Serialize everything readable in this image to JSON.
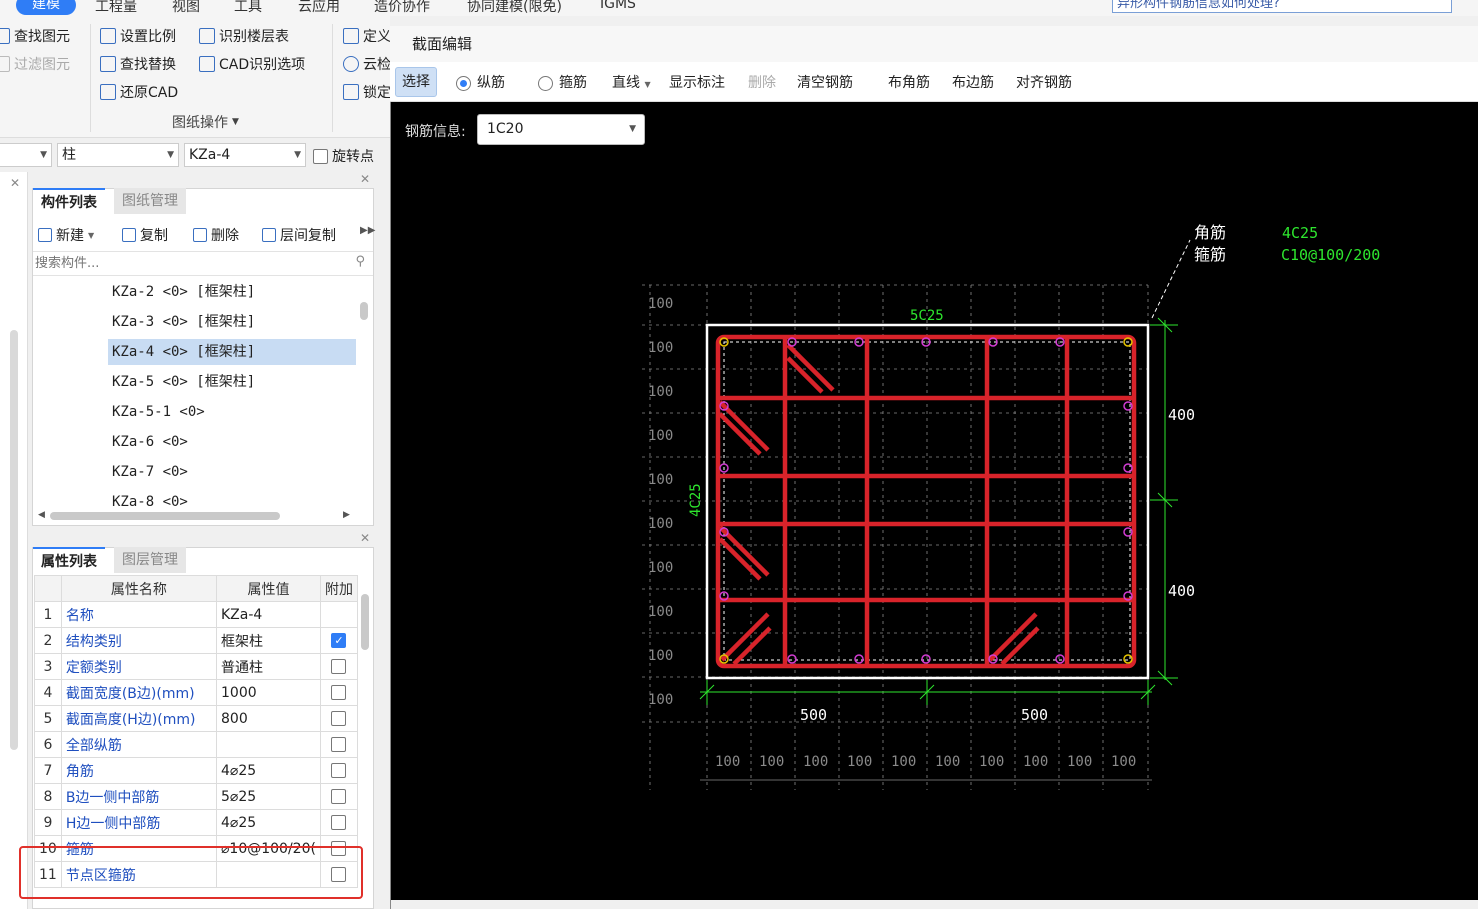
{
  "menu": {
    "items": [
      "建模",
      "工程量",
      "视图",
      "工具",
      "云应用",
      "造价协作",
      "协同建模(限免)",
      "IGMS"
    ],
    "help_search": "异形构件钢筋信息如何处理?"
  },
  "ribbon": {
    "find_element": "查找图元",
    "filter_element": "过滤图元",
    "set_scale": "设置比例",
    "identify_floor_table": "识别楼层表",
    "find_replace": "查找替换",
    "cad_options": "CAD识别选项",
    "restore_cad": "还原CAD",
    "drawing_ops": "图纸操作",
    "define": "定义",
    "cloud": "云检",
    "lock": "锁定"
  },
  "filter_row": {
    "type_value": "柱",
    "element_value": "KZa-4",
    "rotate_point": "旋转点"
  },
  "component_panel": {
    "tab_active": "构件列表",
    "tab_inactive": "图纸管理",
    "new": "新建",
    "copy": "复制",
    "delete": "删除",
    "floor_copy": "层间复制",
    "search_placeholder": "搜索构件...",
    "items": [
      "KZa-2 <0> [框架柱]",
      "KZa-3 <0> [框架柱]",
      "KZa-4 <0> [框架柱]",
      "KZa-5 <0> [框架柱]",
      "KZa-5-1 <0>",
      "KZa-6 <0>",
      "KZa-7 <0>",
      "KZa-8 <0>"
    ],
    "selected_index": 2
  },
  "property_panel": {
    "tab_active": "属性列表",
    "tab_inactive": "图层管理",
    "col_name": "属性名称",
    "col_value": "属性值",
    "col_extra": "附加",
    "rows": [
      {
        "no": "1",
        "name": "名称",
        "value": "KZa-4",
        "checkbox": false,
        "checked": false
      },
      {
        "no": "2",
        "name": "结构类别",
        "value": "框架柱",
        "checkbox": true,
        "checked": true
      },
      {
        "no": "3",
        "name": "定额类别",
        "value": "普通柱",
        "checkbox": true,
        "checked": false
      },
      {
        "no": "4",
        "name": "截面宽度(B边)(mm)",
        "value": "1000",
        "checkbox": true,
        "checked": false
      },
      {
        "no": "5",
        "name": "截面高度(H边)(mm)",
        "value": "800",
        "checkbox": true,
        "checked": false
      },
      {
        "no": "6",
        "name": "全部纵筋",
        "value": "",
        "checkbox": true,
        "checked": false
      },
      {
        "no": "7",
        "name": "角筋",
        "value": "4⌀25",
        "checkbox": true,
        "checked": false
      },
      {
        "no": "8",
        "name": "B边一侧中部筋",
        "value": "5⌀25",
        "checkbox": true,
        "checked": false
      },
      {
        "no": "9",
        "name": "H边一侧中部筋",
        "value": "4⌀25",
        "checkbox": true,
        "checked": false
      },
      {
        "no": "10",
        "name": "箍筋",
        "value": "⌀10@100/20(",
        "checkbox": true,
        "checked": false
      },
      {
        "no": "11",
        "name": "节点区箍筋",
        "value": "",
        "checkbox": true,
        "checked": false
      }
    ]
  },
  "dialog": {
    "title": "截面编辑",
    "select": "选择",
    "longitudinal": "纵筋",
    "stirrup": "箍筋",
    "line": "直线",
    "show_labels": "显示标注",
    "delete": "删除",
    "clear_rebar": "清空钢筋",
    "corner_rebar": "布角筋",
    "edge_rebar": "布边筋",
    "align_rebar": "对齐钢筋",
    "rebar_info_label": "钢筋信息:",
    "rebar_info_value": "1C20"
  },
  "cad": {
    "corner_label": "角筋",
    "stirrup_label": "箍筋",
    "corner_value": "4C25",
    "stirrup_value": "C10@100/200",
    "top_label": "5C25",
    "left_label": "4C25",
    "dim_right_upper": "400",
    "dim_right_lower": "400",
    "dim_bottom_left": "500",
    "dim_bottom_right": "500",
    "grid_v_labels": [
      "100",
      "100",
      "100",
      "100",
      "100",
      "100",
      "100",
      "100",
      "100",
      "100"
    ],
    "grid_h_labels": [
      "100",
      "100",
      "100",
      "100",
      "100",
      "100",
      "100",
      "100",
      "100",
      "100"
    ]
  },
  "colors": {
    "accent": "#2f7df6",
    "rebar": "#d8232a",
    "annotation_green": "#2ee62e",
    "highlight_red": "#e0302a"
  }
}
